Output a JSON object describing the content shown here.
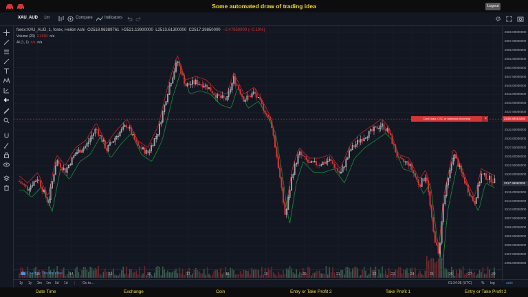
{
  "page": {
    "title": "Some automated draw of trading idea",
    "logout_label": "Logout"
  },
  "toolbar": {
    "symbol": "XAU_AUD",
    "interval": "1m",
    "compare_label": "Compare",
    "indicators_label": "Indicators"
  },
  "legend": {
    "series": "forex:XAU_AUD, 1, forex, Heikin Ashi",
    "open": "O2518.96389761",
    "high": "H2521.13900000",
    "low": "L2513.61300000",
    "close": "C2517.39850000",
    "change": "−2.47950000 (−0.10%)",
    "volume_label": "Volume (20)",
    "volume_value": "2.469K",
    "volume_na": "n/a",
    "ai_label": "AI (1, 1)",
    "ai_na1": "n/a",
    "ai_na2": "n/a"
  },
  "price_axis": {
    "labels": [
      "2560.00000000",
      "2557.50000000",
      "2555.00000000",
      "2552.50000000",
      "2550.00000000",
      "2547.50000000",
      "2545.00000000",
      "2542.50000000",
      "2540.00000000",
      "2537.50000000",
      "2535.00000000",
      "2532.50000000",
      "2530.00000000",
      "2527.50000000",
      "2525.00000000",
      "2522.50000000",
      "2520.00000000",
      "2517.50000000",
      "2515.00000000",
      "2512.50000000",
      "2510.00000000",
      "2507.50000000",
      "2505.00000000",
      "2502.50000000",
      "2500.00000000",
      "2497.50000000",
      "2495.00000000"
    ],
    "current_price": "2535.58583250",
    "last_price": "2517.39850000"
  },
  "alert": {
    "text": "Dont draw, CSC or sideways incoming",
    "close": "×"
  },
  "time_axis": {
    "labels": [
      "13",
      "14",
      "15",
      "16",
      "17",
      "18",
      "19",
      "20",
      "21",
      "22",
      "23",
      "24",
      "25",
      "26",
      "27",
      "30"
    ]
  },
  "bottom_bar": {
    "ranges": [
      "1y",
      "1y",
      "3m",
      "1m",
      "5d",
      "1d"
    ],
    "goto_label": "Go to...",
    "clock": "01:34:38 (UTC)",
    "pct": "%",
    "log": "log",
    "auto": "auto"
  },
  "watermark": "Chart by TradingView",
  "footer": {
    "date_time": "Date Time",
    "exchange": "Exchange",
    "coin": "Coin",
    "entry_tp2a": "Entry or Take Profit 2",
    "take_profit_1": "Take Profit 1",
    "entry_tp2b": "Entry or Take Profit 2"
  },
  "colors": {
    "accent_yellow": "#f5dc2d",
    "bear_red": "#d93336",
    "bull_white": "#e6e6e6",
    "ma_red": "#c62828",
    "ma_green": "#1b8f3a",
    "bg": "#131722"
  }
}
